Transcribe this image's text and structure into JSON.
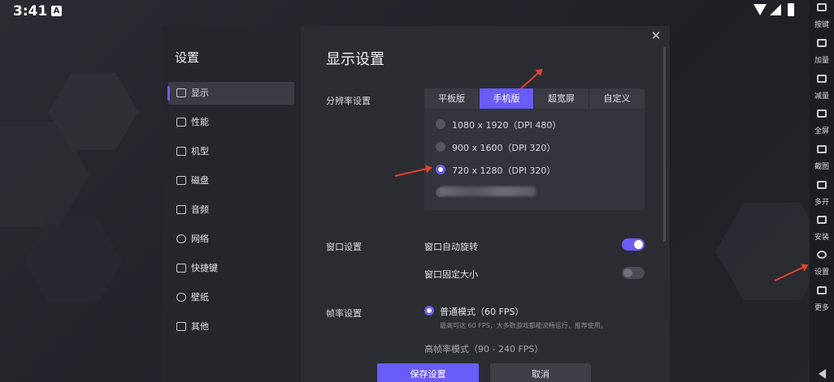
{
  "status_bar": {
    "time": "3:41",
    "notification_icon": "A"
  },
  "toolbar": {
    "items": [
      {
        "label": "按键",
        "icon": "keyboard-icon"
      },
      {
        "label": "加量",
        "icon": "volume-up-icon"
      },
      {
        "label": "减量",
        "icon": "volume-down-icon"
      },
      {
        "label": "全屏",
        "icon": "fullscreen-icon"
      },
      {
        "label": "截图",
        "icon": "scissors-icon"
      },
      {
        "label": "多开",
        "icon": "multi-instance-icon"
      },
      {
        "label": "安装",
        "icon": "install-icon"
      },
      {
        "label": "设置",
        "icon": "gear-icon"
      },
      {
        "label": "更多",
        "icon": "more-icon"
      }
    ],
    "back_icon": "back-triangle-icon"
  },
  "dialog": {
    "sidebar_title": "设置",
    "nav": [
      {
        "label": "显示",
        "icon": "monitor-icon",
        "active": true
      },
      {
        "label": "性能",
        "icon": "performance-icon",
        "active": false
      },
      {
        "label": "机型",
        "icon": "phone-model-icon",
        "active": false
      },
      {
        "label": "磁盘",
        "icon": "disk-icon",
        "active": false
      },
      {
        "label": "音频",
        "icon": "audio-icon",
        "active": false
      },
      {
        "label": "网络",
        "icon": "globe-icon",
        "active": false
      },
      {
        "label": "快捷键",
        "icon": "shortcut-icon",
        "active": false
      },
      {
        "label": "壁纸",
        "icon": "wallpaper-icon",
        "active": false
      },
      {
        "label": "其他",
        "icon": "grid-icon",
        "active": false
      }
    ],
    "title": "显示设置",
    "resolution": {
      "label": "分辨率设置",
      "tabs": [
        "平板版",
        "手机版",
        "超宽屏",
        "自定义"
      ],
      "active_tab": "手机版",
      "options": [
        {
          "label": "1080 x 1920（DPI 480）",
          "checked": false
        },
        {
          "label": "900 x 1600（DPI 320）",
          "checked": false
        },
        {
          "label": "720 x 1280（DPI 320）",
          "checked": true
        }
      ]
    },
    "window": {
      "label": "窗口设置",
      "auto_rotate": {
        "label": "窗口自动旋转",
        "on": true
      },
      "fixed_size": {
        "label": "窗口固定大小",
        "on": false
      }
    },
    "framerate": {
      "label": "帧率设置",
      "normal": {
        "label": "普通模式（60 FPS）",
        "checked": true,
        "hint": "最高可达 60 FPS，大多数游戏都能流畅运行，推荐使用。"
      },
      "high_partial": "高帧率模式（90 - 240 FPS）"
    },
    "buttons": {
      "save": "保存设置",
      "cancel": "取消"
    },
    "close_icon": "close-icon"
  },
  "colors": {
    "accent": "#6a5cf6",
    "annotation": "#e0432f",
    "panel": "#2c2d33",
    "sidebar": "#26272d"
  }
}
